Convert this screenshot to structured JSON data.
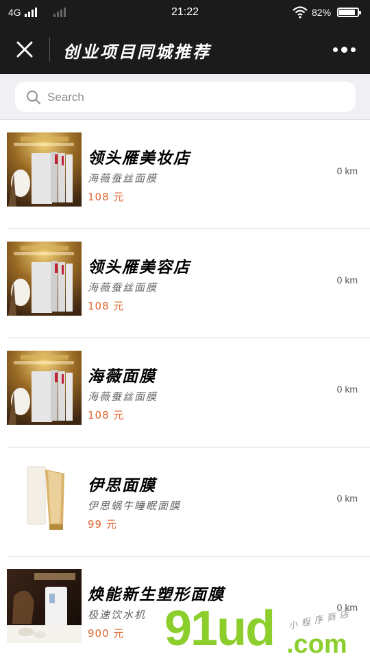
{
  "status_bar": {
    "carrier": "4G",
    "time": "21:22",
    "battery_percent": "82%",
    "battery_level": 0.82
  },
  "nav": {
    "title": "创业项目同城推荐"
  },
  "search": {
    "placeholder": "Search",
    "value": ""
  },
  "items": [
    {
      "name": "领头雁美妆店",
      "desc": "海薇蚕丝面膜",
      "price": "108 元",
      "distance": "0 km",
      "thumb": "mask-box-gold"
    },
    {
      "name": "领头雁美容店",
      "desc": "海薇蚕丝面膜",
      "price": "108 元",
      "distance": "0 km",
      "thumb": "mask-box-gold"
    },
    {
      "name": "海薇面膜",
      "desc": "海薇蚕丝面膜",
      "price": "108 元",
      "distance": "0 km",
      "thumb": "mask-box-gold"
    },
    {
      "name": "伊思面膜",
      "desc": "伊思蜗牛睡眠面膜",
      "price": "99 元",
      "distance": "0 km",
      "thumb": "cream-tube"
    },
    {
      "name": "焕能新生塑形面膜",
      "desc": "极速饮水机",
      "price": "900 元",
      "distance": "0 km",
      "thumb": "water-dispenser"
    }
  ],
  "watermark": {
    "main": "91ud",
    "suffix": ".com",
    "tagline": "小程序商店"
  },
  "colors": {
    "bar_bg": "#1b1b1b",
    "price": "#e0642f",
    "watermark": "#8ccf2c"
  }
}
